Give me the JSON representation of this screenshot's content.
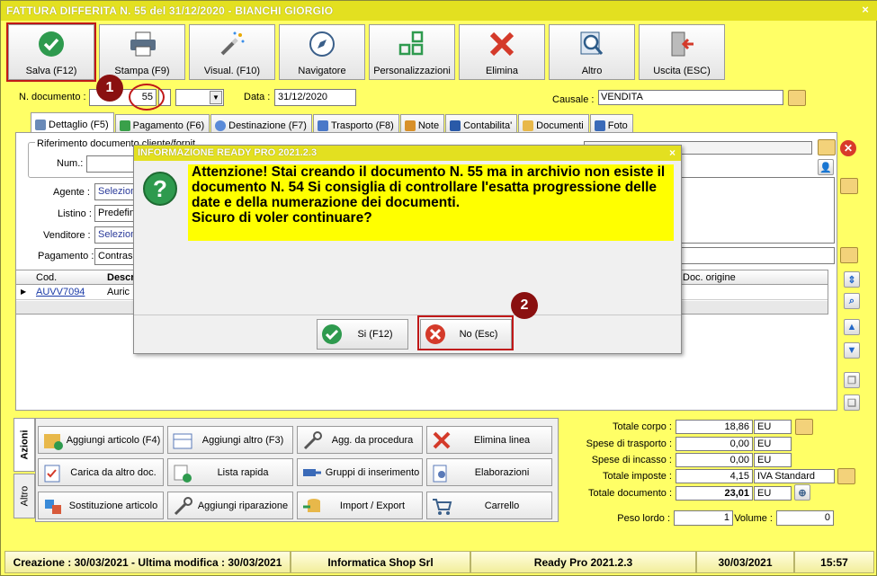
{
  "window": {
    "title": "FATTURA DIFFERITA N. 55 del 31/12/2020 - BIANCHI GIORGIO",
    "close": "×"
  },
  "toolbar": [
    {
      "label": "Salva (F12)",
      "icon": "check-icon"
    },
    {
      "label": "Stampa (F9)",
      "icon": "printer-icon"
    },
    {
      "label": "Visual. (F10)",
      "icon": "magic-wand-icon"
    },
    {
      "label": "Navigatore",
      "icon": "compass-icon"
    },
    {
      "label": "Personalizzazioni",
      "icon": "grid-icon"
    },
    {
      "label": "Elimina",
      "icon": "delete-x-icon"
    },
    {
      "label": "Altro",
      "icon": "magnifier-icon"
    },
    {
      "label": "Uscita (ESC)",
      "icon": "exit-door-icon"
    }
  ],
  "header": {
    "ndoc_label": "N. documento :",
    "ndoc_value": "55",
    "data_label": "Data :",
    "data_value": "31/12/2020",
    "causale_label": "Causale :",
    "causale_value": "VENDITA"
  },
  "tabs": [
    "Dettaglio (F5)",
    "Pagamento (F6)",
    "Destinazione (F7)",
    "Trasporto (F8)",
    "Note",
    "Contabilita'",
    "Documenti",
    "Foto"
  ],
  "detail": {
    "rif_label": "Riferimento documento cliente/fornit.",
    "num_label": "Num.:",
    "agente_label": "Agente :",
    "agente_value": "Selezion",
    "listino_label": "Listino :",
    "listino_value": "Predefin",
    "venditore_label": "Venditore :",
    "venditore_value": "Selezion",
    "pagamento_label": "Pagamento :",
    "pagamento_value": "Contrass"
  },
  "grid": {
    "col_cod": "Cod.",
    "col_desc": "Descr",
    "col_docorig": "Doc. origine",
    "row_cod": "AUVV7094",
    "row_desc": "Auric"
  },
  "actions_tab": "Azioni",
  "altro_tab": "Altro",
  "actions": [
    "Aggiungi articolo (F4)",
    "Aggiungi altro (F3)",
    "Agg. da procedura",
    "Elimina linea",
    "Carica da altro doc.",
    "Lista rapida",
    "Gruppi di inserimento",
    "Elaborazioni",
    "Sostituzione articolo",
    "Aggiungi riparazione",
    "Import / Export",
    "Carrello"
  ],
  "totals": {
    "corpo_label": "Totale corpo :",
    "corpo_value": "18,86",
    "corpo_unit": "EU",
    "trasporto_label": "Spese di trasporto :",
    "trasporto_value": "0,00",
    "trasporto_unit": "EU",
    "incasso_label": "Spese di incasso :",
    "incasso_value": "0,00",
    "incasso_unit": "EU",
    "imposte_label": "Totale imposte :",
    "imposte_value": "4,15",
    "imposte_unit": "IVA Standard",
    "documento_label": "Totale documento :",
    "documento_value": "23,01",
    "documento_unit": "EU",
    "peso_label": "Peso lordo :",
    "peso_value": "1",
    "volume_label": "Volume :",
    "volume_value": "0"
  },
  "statusbar": {
    "created": "Creazione : 30/03/2021 - Ultima modifica : 30/03/2021",
    "company": "Informatica Shop Srl",
    "product": "Ready Pro 2021.2.3",
    "date": "30/03/2021",
    "time": "15:57"
  },
  "dialog": {
    "title": "INFORMAZIONE READY PRO 2021.2.3",
    "close": "×",
    "lines": [
      "Attenzione! Stai creando il documento N. 55 ma in archivio non esiste il",
      "documento N. 54  Si consiglia di controllare l'esatta progressione delle",
      "date e della numerazione dei documenti.",
      "Sicuro di voler continuare?"
    ],
    "yes": "Si (F12)",
    "no": "No (Esc)"
  },
  "badges": [
    "1",
    "2"
  ]
}
